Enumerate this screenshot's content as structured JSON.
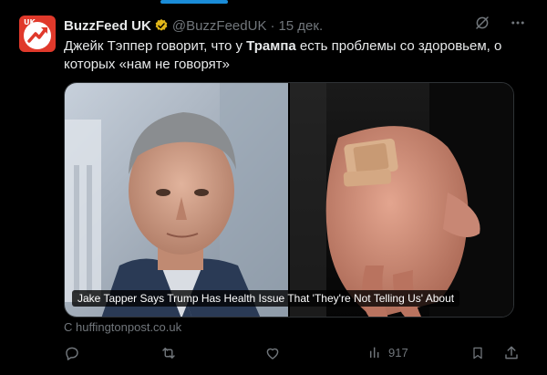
{
  "tweet": {
    "author_name": "BuzzFeed UK",
    "handle": "@BuzzFeedUK",
    "separator": "·",
    "date": "15 дек.",
    "avatar_text": "UK",
    "text_part1": "Джейк Тэппер говорит, что у ",
    "text_bold": "Трампа",
    "text_part2": " есть проблемы со здоровьем, о которых «нам не говорят»",
    "card_caption": "Jake Tapper Says Trump Has Health Issue That 'They're Not Telling Us' About",
    "card_source": "С huffingtonpost.co.uk",
    "views_count": "917"
  },
  "icons": {
    "verified": "verified-badge-icon",
    "grok": "grok-icon",
    "more": "more-icon",
    "reply": "reply-icon",
    "repost": "repost-icon",
    "like": "like-icon",
    "views": "views-icon",
    "bookmark": "bookmark-icon",
    "share": "share-icon"
  },
  "colors": {
    "background": "#000000",
    "text": "#e7e9ea",
    "muted": "#71767b",
    "accent": "#1d9bf0",
    "brand": "#e0392b",
    "verified_gold": "#e2b719"
  }
}
